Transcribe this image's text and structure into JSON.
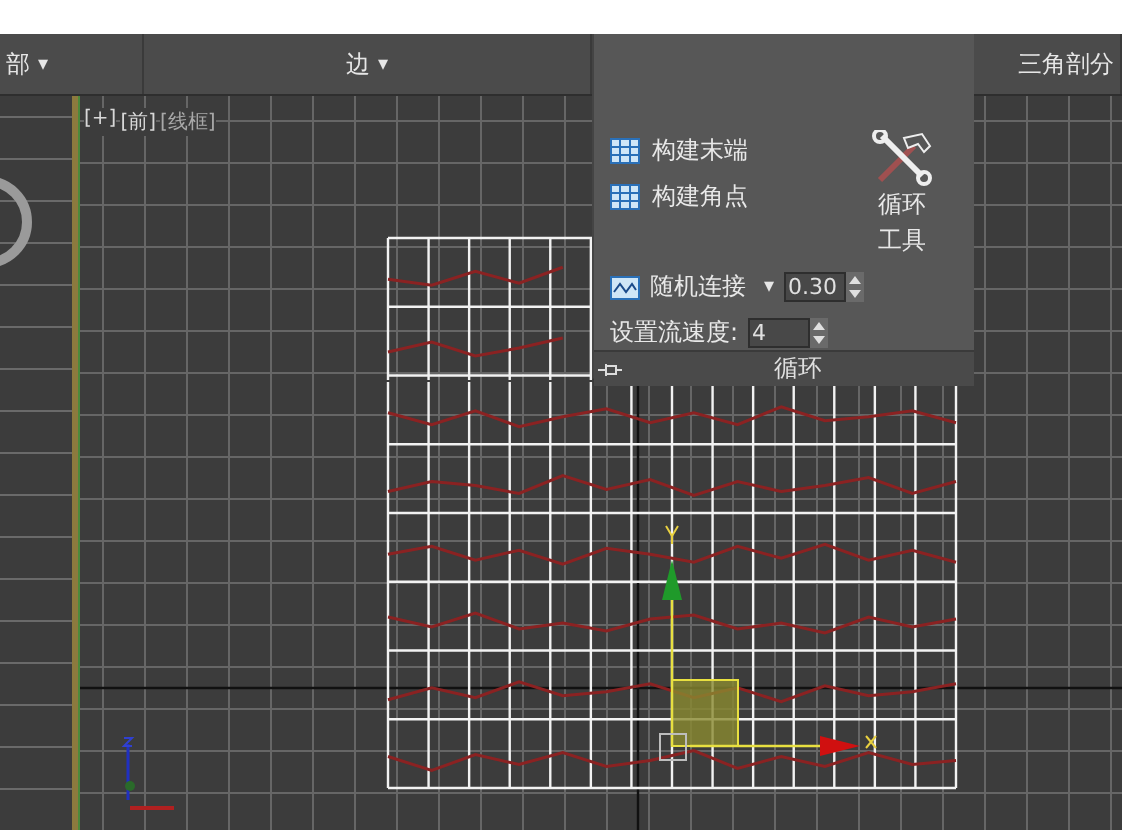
{
  "ribbon": {
    "groups": [
      {
        "label": "部",
        "dropdown": "▾"
      },
      {
        "label": "边",
        "dropdown": "▾"
      },
      {
        "label": "三角剖分"
      }
    ]
  },
  "viewport": {
    "labels": [
      "[+]",
      "[前]",
      "[线框]"
    ]
  },
  "flyout": {
    "buttons": [
      {
        "label": "构建末端"
      },
      {
        "label": "构建角点"
      }
    ],
    "tool_label": [
      "循环",
      "工具"
    ],
    "random_connect": {
      "label": "随机连接",
      "dropdown": "▾",
      "value": "0.30"
    },
    "flow_speed": {
      "label": "设置流速度:",
      "value": "4"
    },
    "footer_title": "循环"
  }
}
